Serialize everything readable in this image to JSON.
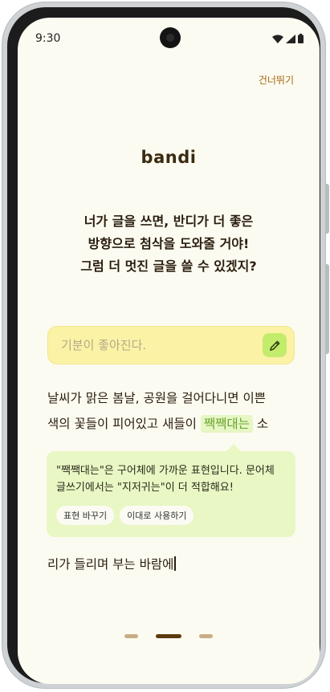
{
  "status_bar": {
    "time": "9:30"
  },
  "header": {
    "skip_label": "건너뛰기"
  },
  "brand": {
    "logo_text": "bandi"
  },
  "headline": {
    "lines": [
      "너가 글을 쓰면, 반디가 더 좋은",
      "방향으로 첨삭을 도와줄 거야!",
      "그럼 더 멋진 글을 쓸 수 있겠지?"
    ]
  },
  "mood_input": {
    "placeholder": "기분이 좋아진다.",
    "value": ""
  },
  "editor": {
    "line1": "날씨가 맑은 봄날, 공원을 걸어다니면 이쁜",
    "line2_before": "색의 꽃들이 피어있고 새들이 ",
    "highlight": "짹짹대는",
    "line2_after": " 소",
    "line3": "리가 들리며 부는 바람에"
  },
  "suggestion": {
    "lines": [
      "\"짹짹대는\"은 구어체에 가까운 표현입니다. 문어체",
      "글쓰기에서는 \"지저귀는\"이 더 적합해요!"
    ],
    "rephrase_label": "표현 바꾸기",
    "keep_label": "이대로 사용하기"
  },
  "pagination": {
    "total": 3,
    "current": 2
  },
  "colors": {
    "background": "#fcfbf1",
    "accent": "#a0680e",
    "highlight": "#6aa42c",
    "input_bg": "#fbf2a6",
    "suggestion_bg": "#e8f7c4"
  },
  "icons": {
    "edit": "pencil-icon",
    "wifi": "wifi-icon",
    "signal": "signal-icon",
    "battery": "battery-icon"
  }
}
